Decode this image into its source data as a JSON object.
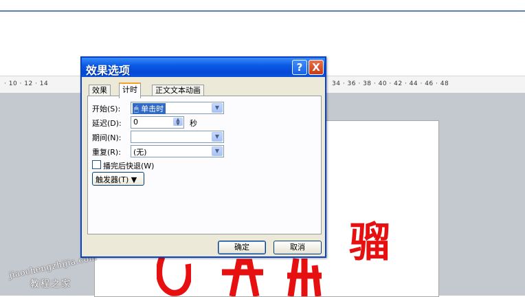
{
  "ruler": {
    "left_labels": "· 10 · 12 · 14",
    "right_labels": "34 · 36 · 38 · 40 · 42 · 44 · 46 · 48"
  },
  "dialog": {
    "title": "效果选项",
    "help_glyph": "?",
    "close_glyph": "X",
    "tabs": [
      "效果",
      "计时",
      "正文文本动画"
    ],
    "active_tab": "计时",
    "fields": {
      "start": {
        "label": "开始(S):",
        "value": "单击时"
      },
      "delay": {
        "label": "延迟(D):",
        "value": "0",
        "unit": "秒"
      },
      "duration": {
        "label": "期间(N):",
        "value": ""
      },
      "repeat": {
        "label": "重复(R):",
        "value": "(无)"
      }
    },
    "rewind_checkbox": {
      "label": "播完后快退(W)",
      "checked": false
    },
    "trigger_button": "触发器(T) ▼",
    "ok_button": "确定",
    "cancel_button": "取消"
  },
  "watermark": {
    "latin": "jiaochengzhijia.com",
    "chinese": "教程之家"
  },
  "slide": {
    "chars": [
      "骝"
    ],
    "accent_color": "#e61010"
  },
  "colors": {
    "titlebar": "#0a5ae6",
    "topline": "#5b7fb8"
  }
}
